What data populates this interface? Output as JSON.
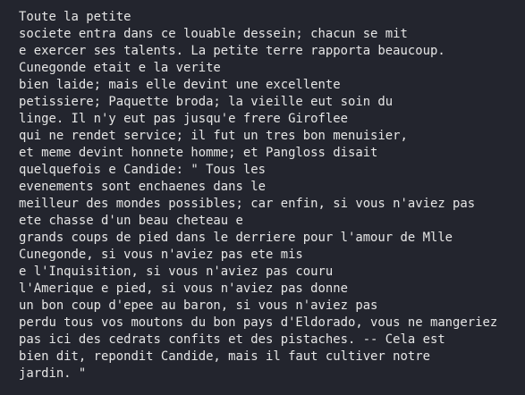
{
  "terminal": {
    "lines": [
      "Toute la petite",
      "societe entra dans ce louable dessein; chacun se mit",
      "e exercer ses talents. La petite terre rapporta beaucoup.",
      "Cunegonde etait e la verite",
      "bien laide; mais elle devint une excellente",
      "petissiere; Paquette broda; la vieille eut soin du",
      "linge. Il n'y eut pas jusqu'e frere Giroflee",
      "qui ne rendet service; il fut un tres bon menuisier,",
      "et meme devint honnete homme; et Pangloss disait",
      "quelquefois e Candide: \" Tous les",
      "evenements sont enchaenes dans le",
      "meilleur des mondes possibles; car enfin, si vous n'aviez pas",
      "ete chasse d'un beau cheteau e",
      "grands coups de pied dans le derriere pour l'amour de Mlle",
      "Cunegonde, si vous n'aviez pas ete mis",
      "e l'Inquisition, si vous n'aviez pas couru",
      "l'Amerique e pied, si vous n'aviez pas donne",
      "un bon coup d'epee au baron, si vous n'aviez pas",
      "perdu tous vos moutons du bon pays d'Eldorado, vous ne mangeriez",
      "pas ici des cedrats confits et des pistaches. -- Cela est",
      "bien dit, repondit Candide, mais il faut cultiver notre",
      "jardin. \""
    ]
  }
}
